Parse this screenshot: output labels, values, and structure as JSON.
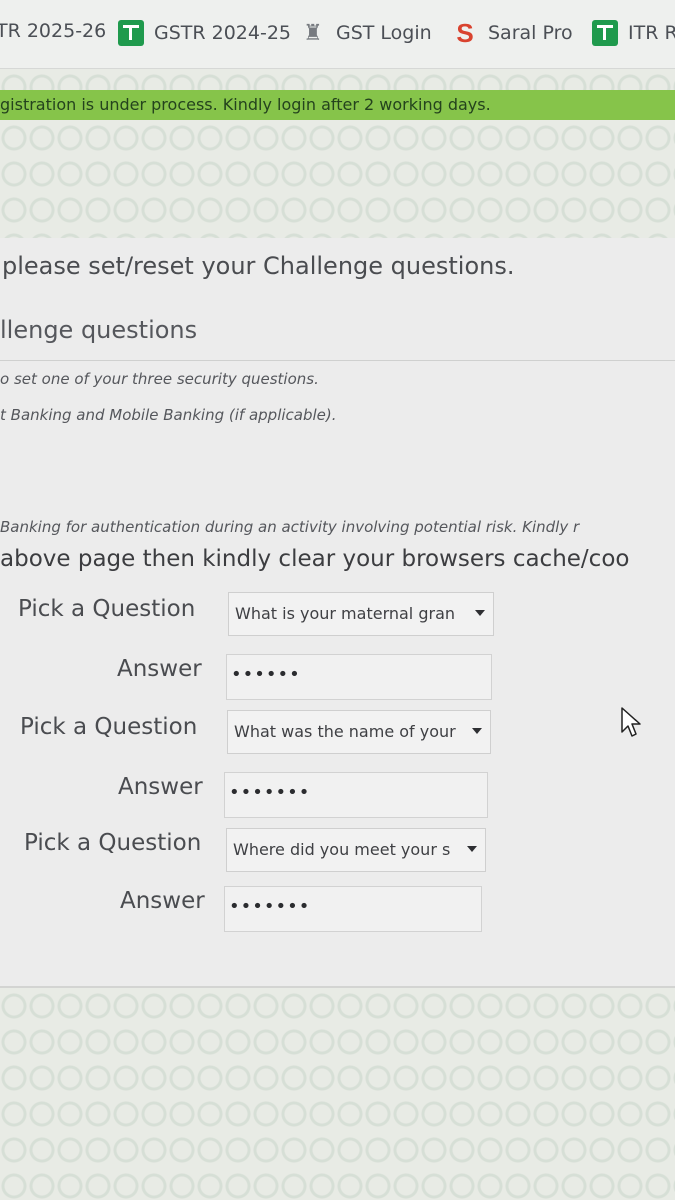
{
  "bookmarks": [
    {
      "label": "TR 2025-26",
      "icon": ""
    },
    {
      "label": "GSTR 2024-25",
      "icon": "green-tax-icon"
    },
    {
      "label": "GST Login",
      "icon": "emblem-icon"
    },
    {
      "label": "Saral Pro",
      "icon": "saral-logo-icon"
    },
    {
      "label": "ITR R",
      "icon": "green-tax-icon"
    }
  ],
  "notice": "gistration is under process. Kindly login after 2 working days.",
  "heading": "please set/reset your Challenge questions.",
  "subheading": "llenge questions",
  "info_lines": [
    "o set one of your three security questions.",
    "t Banking and Mobile Banking (if applicable)."
  ],
  "risk_line": "Banking for authentication during an activity involving potential risk. Kindly r",
  "cache_line": "above page then kindly clear your browsers cache/coo",
  "form": {
    "question_label": "Pick a Question",
    "answer_label": "Answer",
    "rows": [
      {
        "question": "What is your maternal gran",
        "answer": "••••••"
      },
      {
        "question": "What was the name of your",
        "answer": "•••••••"
      },
      {
        "question": "Where did you meet your s",
        "answer": "•••••••"
      }
    ]
  },
  "colors": {
    "notice_bg": "#86c44a",
    "page_bg": "#e9eae6",
    "icon_green": "#1f9a4d"
  }
}
